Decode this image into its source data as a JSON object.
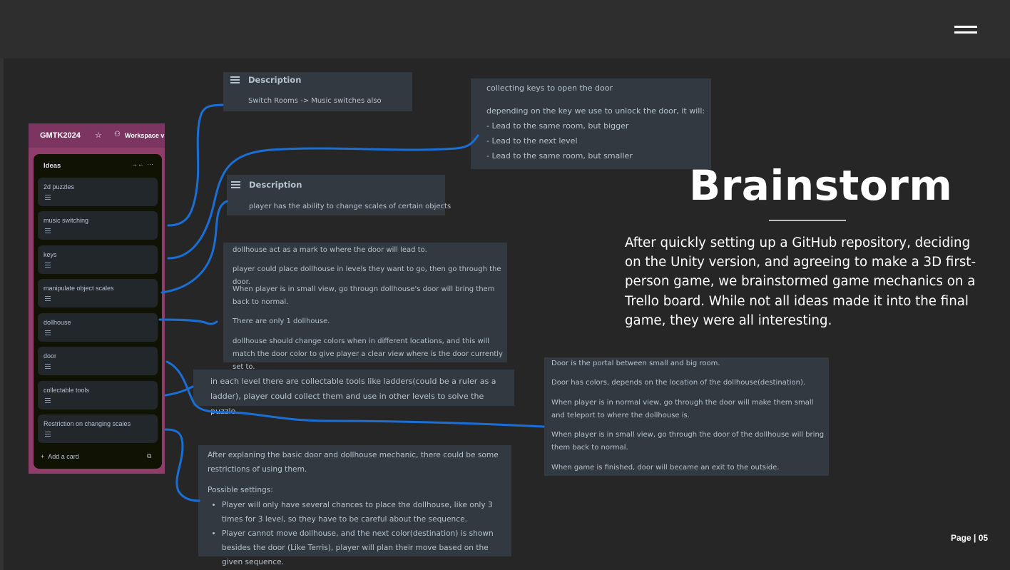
{
  "slide": {
    "title": "Brainstorm",
    "paragraph": "After quickly setting up a GitHub repository, deciding on the Unity version, and agreeing to make a 3D first-person game, we brainstormed game mechanics on a Trello board. While not all ideas made it into the final game, they were all interesting.",
    "page": "Page | 05"
  },
  "trello": {
    "board_title": "GMTK2024",
    "workspace_label": "Workspace vi",
    "list_title": "Ideas",
    "cards": [
      {
        "title": "2d puzzles"
      },
      {
        "title": "music switching"
      },
      {
        "title": "keys"
      },
      {
        "title": "manipulate object scales"
      },
      {
        "title": "dollhouse"
      },
      {
        "title": "door"
      },
      {
        "title": "collectable tools"
      },
      {
        "title": "Restriction on changing scales"
      }
    ],
    "add_card_label": "Add a card"
  },
  "notes": {
    "music": {
      "heading": "Description",
      "text": "Switch Rooms -> Music switches also"
    },
    "keys": {
      "line1": "collecting keys to open the door",
      "line2": "depending on the key we use to unlock the door, it will:",
      "line3": "- Lead to the same room, but bigger",
      "line4": "- Lead to the next level",
      "line5": "- Lead to the same room, but smaller"
    },
    "scales": {
      "heading": "Description",
      "text": "player has the ability to change scales of certain objects"
    },
    "dollhouse": {
      "p1": "dollhouse act as a mark to where the door will lead to.",
      "p2": "player could place dollhouse in levels they want to go, then go through the door.",
      "p3": "When player is in small view, go througn dollhouse's door will bring them back to normal.",
      "p4": "There are only 1 dollhouse.",
      "p5": "dollhouse should change colors when in different locations, and this will match the door color to give player a clear view where is the door currently set to."
    },
    "tools": {
      "text": "in each level there are collectable tools like ladders(could be a ruler as a ladder), player could collect them and use in other levels to solve the puzzle."
    },
    "door": {
      "p1": "Door is the portal between small and big room.",
      "p2": "Door has colors, depends on the location of the dollhouse(destination).",
      "p3": "When player is in normal view, go through the door will make them small and teleport to where the dollhouse is.",
      "p4": "When player is in small view, go through the door of the dollhouse will bring them back to normal.",
      "p5": "When game is finished, door will became an exit to the outside."
    },
    "restriction": {
      "p1": "After explaning the basic door and dollhouse mechanic, there could be some restrictions of using them.",
      "p2": "Possible settings:",
      "b1": "Player will only have several chances to place the dollhouse, like only 3 times for 3 level, so they have to be careful about the sequence.",
      "b2": "Player cannot move dollhouse, and the next color(destination) is shown besides the door (Like Terris), player will plan their move based on the given sequence."
    }
  }
}
